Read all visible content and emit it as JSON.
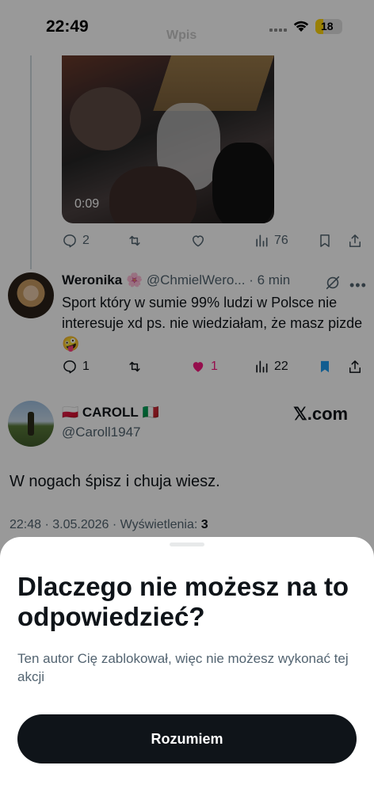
{
  "status_bar": {
    "time": "22:49",
    "battery": "18"
  },
  "ghost_title": "Wpis",
  "video": {
    "duration": "0:09"
  },
  "first_tweet_actions": {
    "replies": "2",
    "likes": "",
    "views": "76"
  },
  "reply_tweet": {
    "name": "Weronika",
    "emoji": "🌸",
    "handle": "@ChmielWero...",
    "time": "· 6 min",
    "text": "Sport który w sumie 99% ludzi w Polsce nie interesuje xd ps. nie wiedziałam, że masz pizde 🤪",
    "replies": "1",
    "likes": "1",
    "views": "22"
  },
  "main_tweet": {
    "flag_left": "🇵🇱",
    "name": "CAROLL",
    "flag_right": "🇮🇹",
    "handle": "@Caroll1947",
    "watermark": "𝕏.com",
    "text": "W nogach śpisz i chuja wiesz.",
    "meta_prefix": "22:48 · 3.05.2026 · Wyświetlenia: ",
    "meta_views": "3"
  },
  "sheet": {
    "title": "Dlaczego nie możesz na to odpowiedzieć?",
    "description": "Ten autor Cię zablokował, więc nie możesz wykonać tej akcji",
    "button_label": "Rozumiem"
  },
  "colors": {
    "like_pink": "#f91880",
    "bookmark_blue": "#1d9bf0",
    "muted": "#536471",
    "button_dark": "#0f1419"
  }
}
